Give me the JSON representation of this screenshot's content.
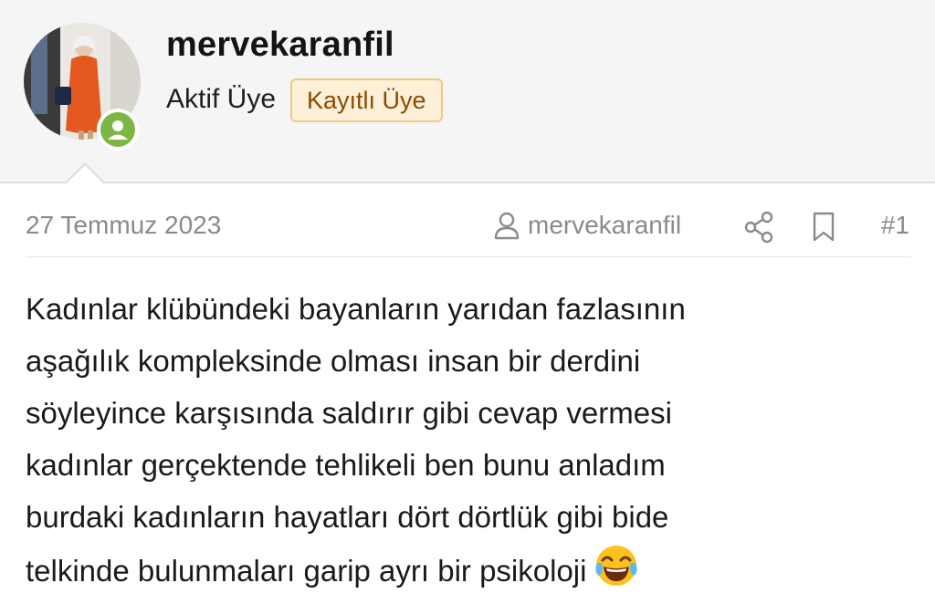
{
  "user": {
    "username": "mervekaranfil",
    "title": "Aktif Üye",
    "badge": "Kayıtlı Üye",
    "avatar_icon": "avatar-photo",
    "status_icon": "online-user-icon",
    "status_color": "#7cb743"
  },
  "post": {
    "date": "27 Temmuz 2023",
    "author": "mervekaranfil",
    "number": "#1",
    "lines": [
      "Kadınlar klübündeki bayanların yarıdan fazlasının",
      "aşağılık kompleksinde olması insan bir derdini",
      "söyleyince karşısında saldırır gibi cevap vermesi",
      "kadınlar gerçektende tehlikeli ben bunu anladım",
      "burdaki kadınların hayatları dört dörtlük gibi bide",
      "telkinde bulunmaları garip ayrı bir psikoloji"
    ],
    "emoji_icon": "tears-of-joy-emoji-icon"
  },
  "colors": {
    "header_bg": "#f5f5f5",
    "badge_bg": "#fdf0d9",
    "badge_border": "#f0c781",
    "badge_text": "#8a4b00",
    "muted_text": "#8a8a8a"
  }
}
